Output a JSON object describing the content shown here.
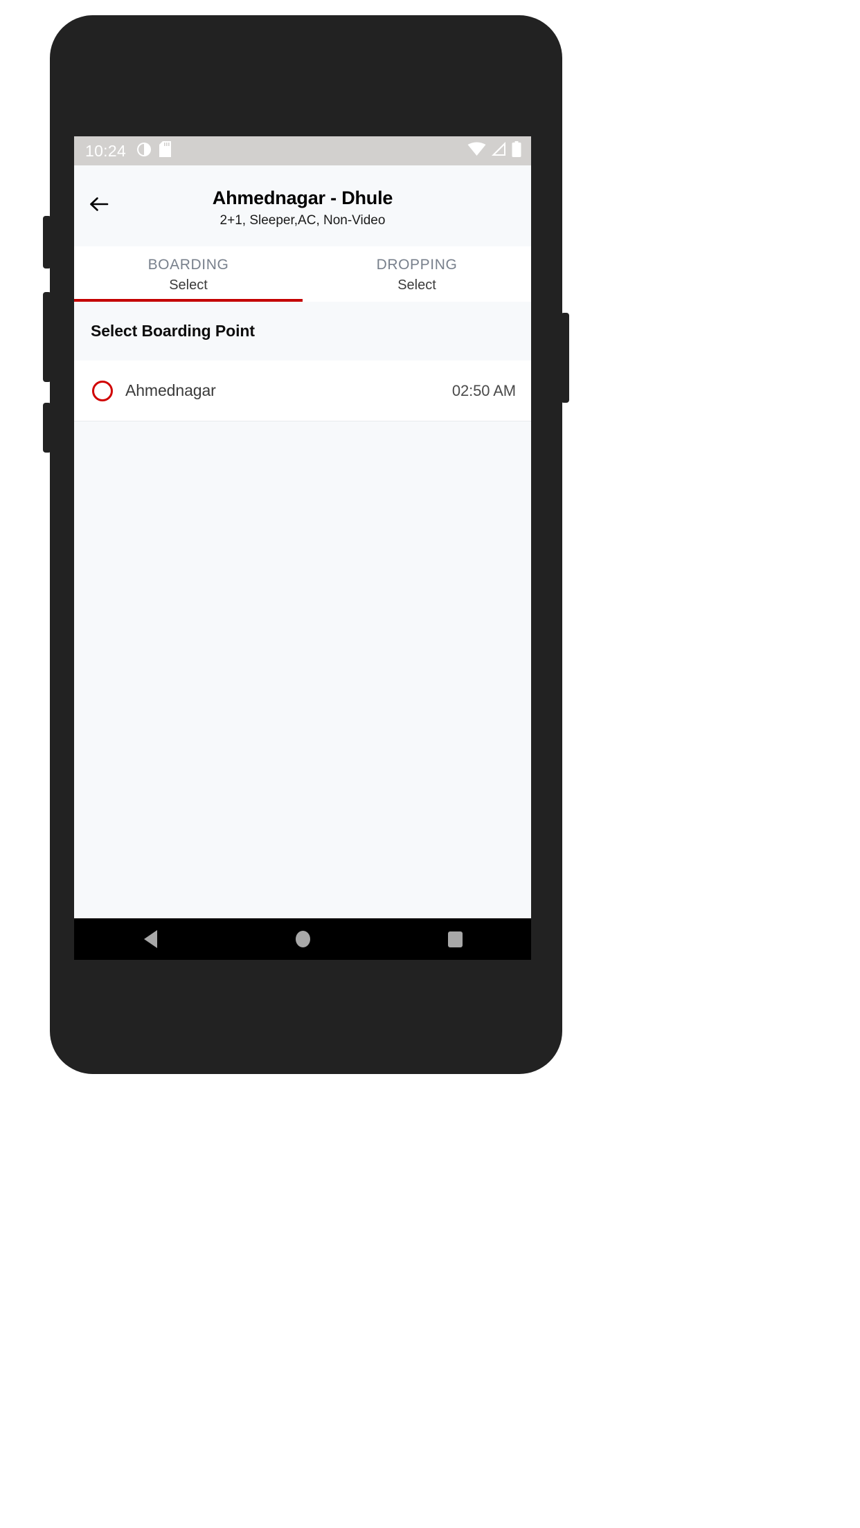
{
  "status_bar": {
    "time": "10:24",
    "icons_left": [
      "data-saver-icon",
      "sd-card-icon"
    ],
    "icons_right": [
      "wifi-icon",
      "cellular-signal-icon",
      "battery-icon"
    ],
    "background_color": "#d2d0ce"
  },
  "app_bar": {
    "back_icon": "arrow-left-icon",
    "title": "Ahmednagar - Dhule",
    "subtitle": "2+1, Sleeper,AC, Non-Video"
  },
  "tabs": {
    "active_index": 0,
    "indicator_color": "#c40000",
    "items": [
      {
        "title": "BOARDING",
        "value": "Select"
      },
      {
        "title": "DROPPING",
        "value": "Select"
      }
    ]
  },
  "section": {
    "header": "Select Boarding Point"
  },
  "boarding_points": [
    {
      "name": "Ahmednagar",
      "time": "02:50 AM",
      "selected": false,
      "radio_color": "#d00000"
    }
  ],
  "nav_bar": {
    "items": [
      "back-icon",
      "home-icon",
      "recents-icon"
    ],
    "background_color": "#000000"
  },
  "device": {
    "buttons": [
      "volume-up",
      "volume-down",
      "mute",
      "power"
    ]
  }
}
